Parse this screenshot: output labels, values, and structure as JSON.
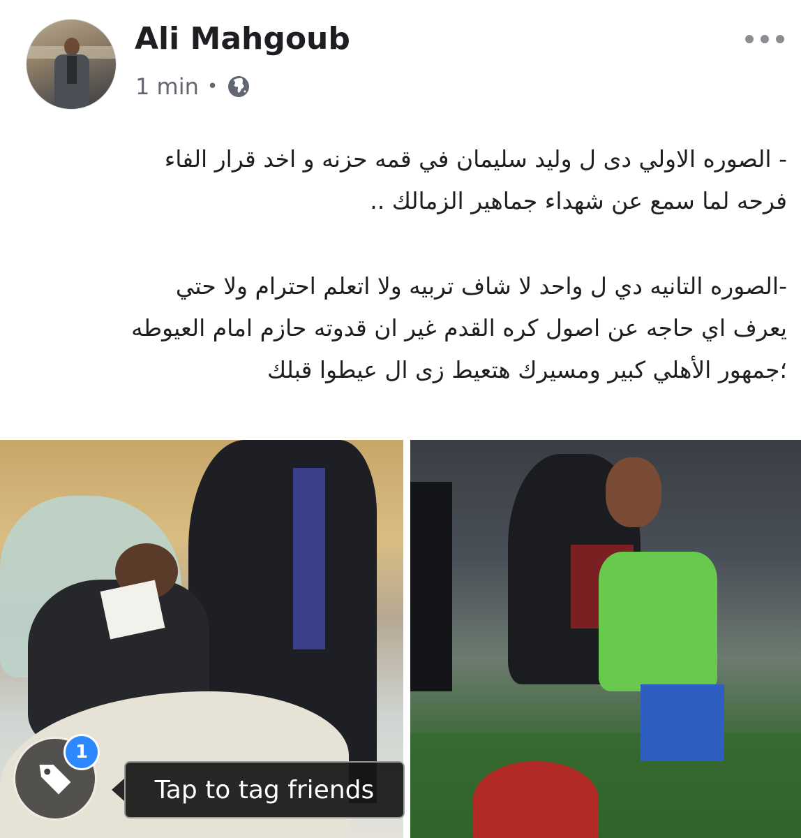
{
  "post": {
    "author_name": "Ali Mahgoub",
    "time": "1 min",
    "separator": "•",
    "privacy_icon": "globe-icon",
    "menu_icon": "more-horizontal-icon"
  },
  "text": {
    "line1": "- الصوره الاولي دى ل وليد سليمان في قمه حزنه و اخد قرار الفاء",
    "line2": "فرحه لما سمع عن شهداء جماهير الزمالك ..",
    "line3": "-الصوره التانيه دي ل واحد لا شاف تربيه ولا اتعلم احترام ولا حتي",
    "line4": "يعرف اي حاجه عن اصول كره القدم غير ان قدوته حازم امام العيوطه",
    "line5": "؛جمهور الأهلي كبير ومسيرك هتعيط زى ال عيطوا قبلك"
  },
  "tagging": {
    "badge_count": "1",
    "tooltip": "Tap to tag friends",
    "icon": "tag-icon"
  },
  "colors": {
    "name": "#1c1e21",
    "meta": "#606770",
    "badge": "#2d88ff"
  }
}
